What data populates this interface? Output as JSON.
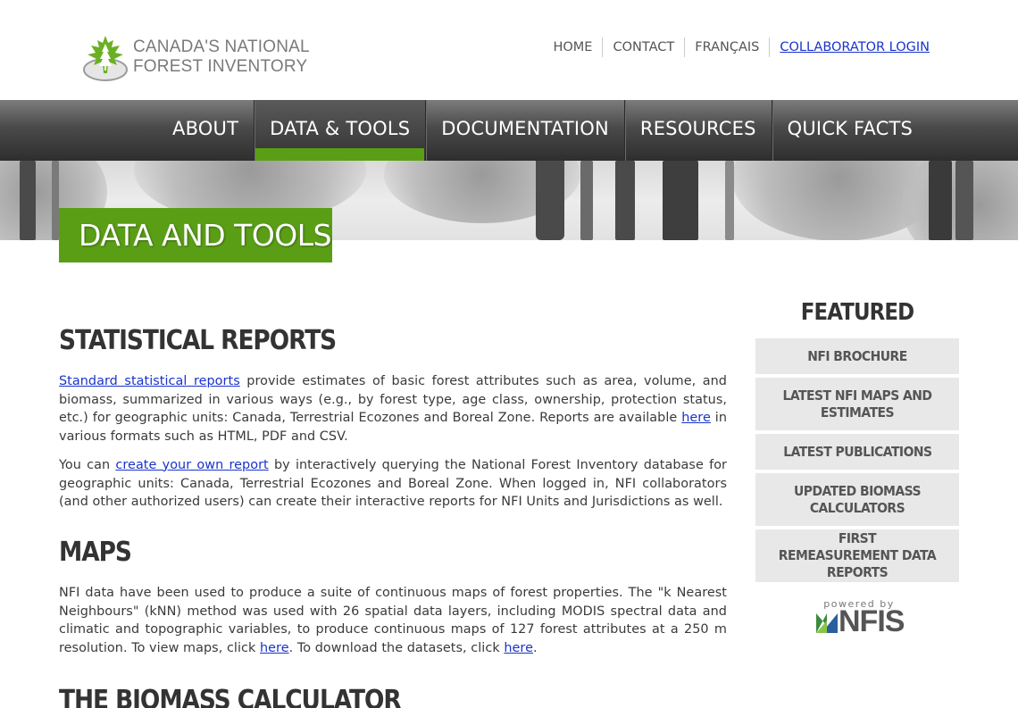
{
  "logo": {
    "line1": "CANADA'S NATIONAL",
    "line2": "FOREST INVENTORY"
  },
  "top_nav": [
    "HOME",
    "CONTACT",
    "FRANÇAIS",
    "COLLABORATOR LOGIN"
  ],
  "main_nav": [
    "ABOUT",
    "DATA & TOOLS",
    "DOCUMENTATION",
    "RESOURCES",
    "QUICK FACTS"
  ],
  "main_nav_active": "DATA & TOOLS",
  "page_title": "DATA AND TOOLS",
  "colors": {
    "accent_green": "#5a9e16",
    "link_blue": "#1a33cc",
    "nav_dark": "#333333"
  },
  "sections": {
    "statistical": {
      "heading": "STATISTICAL REPORTS",
      "p1_link": "Standard statistical reports",
      "p1_text1": " provide estimates of basic forest attributes such as area, volume, and biomass, summarized in various ways (e.g., by forest type, age class, ownership, protection status, etc.) for geographic units: Canada, Terrestrial Ecozones and Boreal Zone. Reports are available ",
      "p1_here": "here",
      "p1_text2": " in various formats such as HTML, PDF and CSV.",
      "p2_text1": "You can ",
      "p2_link": "create your own report",
      "p2_text2": " by interactively querying the National Forest Inventory database for geographic units: Canada, Terrestrial Ecozones and Boreal Zone. When logged in, NFI collaborators (and other authorized users) can create their interactive reports for NFI Units and Jurisdictions as well."
    },
    "maps": {
      "heading": "MAPS",
      "text1": "NFI data have been used to produce a suite of continuous maps of forest properties. The \"k Nearest Neighbours\" (kNN) method was used with 26 spatial data layers, including MODIS spectral data and climatic and topographic variables, to produce continuous maps of 127 forest attributes at a 250 m resolution. To view maps, click ",
      "here1": "here",
      "text2": ". To download the datasets, click ",
      "here2": "here",
      "text3": "."
    },
    "biomass": {
      "heading": "THE BIOMASS CALCULATOR"
    }
  },
  "sidebar": {
    "heading": "FEATURED",
    "items": [
      "NFI BROCHURE",
      "LATEST NFI MAPS AND ESTIMATES",
      "LATEST PUBLICATIONS",
      "UPDATED BIOMASS CALCULATORS",
      "FIRST REMEASUREMENT DATA REPORTS"
    ],
    "powered_by": "powered by",
    "nfis": "NFIS"
  }
}
